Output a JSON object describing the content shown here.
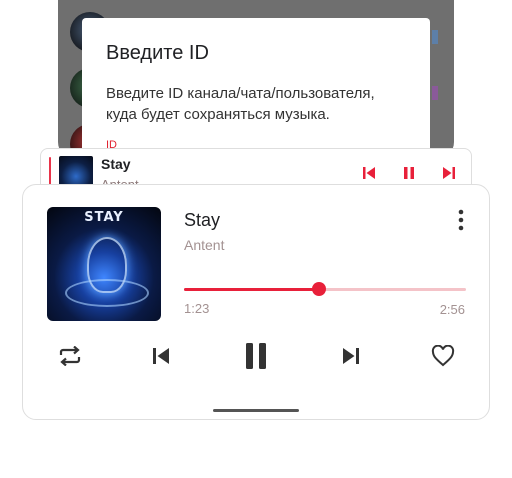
{
  "dialog": {
    "title": "Введите ID",
    "message": "Введите ID канала/чата/пользователя, куда будет сохраняться музыка.",
    "hint": "ID"
  },
  "mini_player": {
    "title": "Stay",
    "artist": "Antent",
    "accent_color": "#e8344a",
    "icons": [
      "skip-previous-icon",
      "pause-icon",
      "skip-next-icon"
    ]
  },
  "player": {
    "title": "Stay",
    "artist": "Antent",
    "cover_text": "STAY",
    "current_time": "1:23",
    "total_time": "2:56",
    "progress": 0.48,
    "accent_color": "#e8203a",
    "controls": [
      "repeat-icon",
      "skip-previous-icon",
      "pause-icon",
      "skip-next-icon",
      "heart-icon"
    ]
  }
}
